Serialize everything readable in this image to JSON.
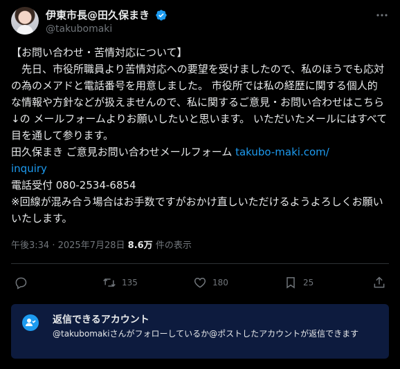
{
  "author": {
    "display_name": "伊東市長@田久保まき",
    "handle": "@takubomaki",
    "verified": true
  },
  "post": {
    "line1": "【お問い合わせ・苦情対応について】",
    "paragraph": "　先日、市役所職員より苦情対応への要望を受けましたので、私のほうでも応対の為のメアドと電話番号を用意しました。 市役所では私の経歴に関する個人的な情報や方針などが扱えませんので、私に関するご意見・お問い合わせはこちら↓の メールフォームよりお願いしたいと思います。 いただいたメールにはすべて目を通して参ります。",
    "form_label": "田久保まき ご意見お問い合わせメールフォーム ",
    "form_link": "takubo-maki.com/\ninquiry",
    "phone": "電話受付 080-2534-6854",
    "note": "※回線が混み合う場合はお手数ですがおかけ直しいただけるようよろしくお願いいたします。"
  },
  "meta": {
    "time": "午後3:34",
    "separator": " · ",
    "date": "2025年7月28日",
    "views": "8.6万",
    "views_label": " 件の表示"
  },
  "actions": {
    "reply_count": "",
    "retweet_count": "135",
    "like_count": "180",
    "bookmark_count": "25"
  },
  "reply_settings": {
    "title": "返信できるアカウント",
    "text": "@takubomakiさんがフォローしているか@ポストしたアカウントが返信できます"
  },
  "colors": {
    "background": "#000000",
    "text": "#e7e9ea",
    "muted": "#71767b",
    "link": "#1d9bf0",
    "reply_box": "#0d1b3e"
  },
  "icons": [
    "more-icon",
    "verified-icon",
    "reply-icon",
    "retweet-icon",
    "like-icon",
    "bookmark-icon",
    "share-icon",
    "person-check-icon"
  ]
}
